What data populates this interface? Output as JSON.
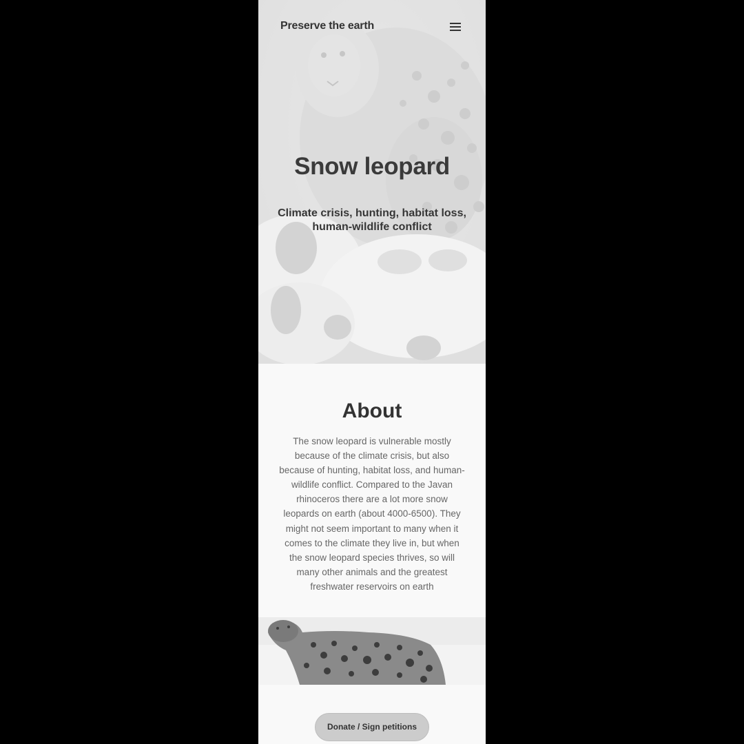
{
  "header": {
    "brand": "Preserve the earth",
    "menu_icon": "hamburger-menu-icon"
  },
  "hero": {
    "title": "Snow leopard",
    "subtitle": "Climate crisis, hunting, habitat loss, human-wildlife conflict"
  },
  "about": {
    "title": "About",
    "body": "The snow leopard is vulnerable mostly because of the climate crisis, but also because of hunting, habitat loss, and human-wildlife conflict. Compared to the Javan rhinoceros there are a lot more snow leopards on earth (about 4000-6500). They might not seem important to many when it comes to the climate they live in, but when the snow leopard species thrives, so will many other animals and the greatest freshwater reservoirs on earth"
  },
  "cta": {
    "label": "Donate / Sign petitions"
  },
  "colors": {
    "page_background": "#000000",
    "content_background": "#f9f9f9",
    "button_background": "#cccccc",
    "heading_text": "#333333",
    "body_text": "#666666"
  }
}
